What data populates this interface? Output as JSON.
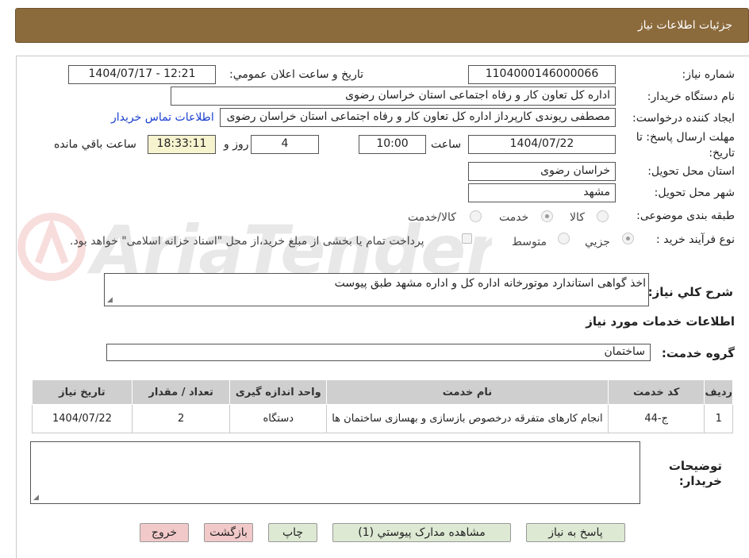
{
  "header": {
    "title": "جزئيات اطلاعات نياز"
  },
  "fields": {
    "need_number_label": "شماره نياز:",
    "need_number": "1104000146000066",
    "announce_label": "تاريخ و ساعت اعلان عمومي:",
    "announce_value": "1404/07/17 - 12:21",
    "buyer_org_label": "نام دستگاه خريدار:",
    "buyer_org": "اداره کل تعاون  کار و رفاه اجتماعی استان خراسان رضوی",
    "requester_label": "ايجاد کننده درخواست:",
    "requester": "مصطفی  ریوندی کارپرداز اداره کل تعاون  کار و رفاه اجتماعی استان خراسان رضوی",
    "contact_link": "اطلاعات تماس خريدار",
    "deadline_label_line1": "مهلت ارسال پاسخ: تا",
    "deadline_label_line2": "تاريخ:",
    "deadline_date": "1404/07/22",
    "time_label": "ساعت",
    "deadline_time": "10:00",
    "days_value": "4",
    "day_and_label": "روز و",
    "remaining_time": "18:33:11",
    "remaining_label": "ساعت باقي مانده",
    "province_label": "استان محل تحويل:",
    "province": "خراسان رضوی",
    "city_label": "شهر محل تحويل:",
    "city": "مشهد",
    "category_label": "طبقه بندی موضوعی:",
    "category_options": [
      "کالا",
      "خدمت",
      "کالا/خدمت"
    ],
    "category_selected": "خدمت",
    "process_label": "نوع فرآيند خريد :",
    "process_options": [
      "جزيي",
      "متوسط"
    ],
    "process_selected": "جزيي",
    "payment_note": "پرداخت تمام یا بخشی از مبلغ خرید،از محل \"اسناد خزانه اسلامی\" خواهد بود."
  },
  "description": {
    "label": "شرح کلي نياز:",
    "value": "اخذ گواهی استاندارد موتورخانه اداره کل و اداره مشهد طبق پیوست"
  },
  "services": {
    "section_title": "اطلاعات خدمات مورد نياز",
    "group_label": "گروه خدمت:",
    "group_value": "ساختمان",
    "columns": [
      "رديف",
      "کد خدمت",
      "نام خدمت",
      "واحد اندازه گيری",
      "تعداد / مقدار",
      "تاريخ نياز"
    ],
    "rows": [
      [
        "1",
        "ج-44",
        "انجام کارهای متفرقه درخصوص بازسازی و بهسازی ساختمان ها",
        "دستگاه",
        "2",
        "1404/07/22"
      ]
    ]
  },
  "buyer_notes": {
    "label_line1": "توضيحات",
    "label_line2": "خريدار:",
    "value": ""
  },
  "buttons": {
    "reply": "پاسخ به نياز",
    "attachments": "مشاهده مدارک پيوستي (1)",
    "print": "چاپ",
    "back": "بازگشت",
    "exit": "خروج"
  },
  "watermark": {
    "text": "AriaTender.neT"
  },
  "colors": {
    "header": "#8b6a3c",
    "timer_bg": "#f6f3cf",
    "button_green": "#dde9d3",
    "button_red": "#f2c9c9",
    "link": "#1a3fd0"
  }
}
